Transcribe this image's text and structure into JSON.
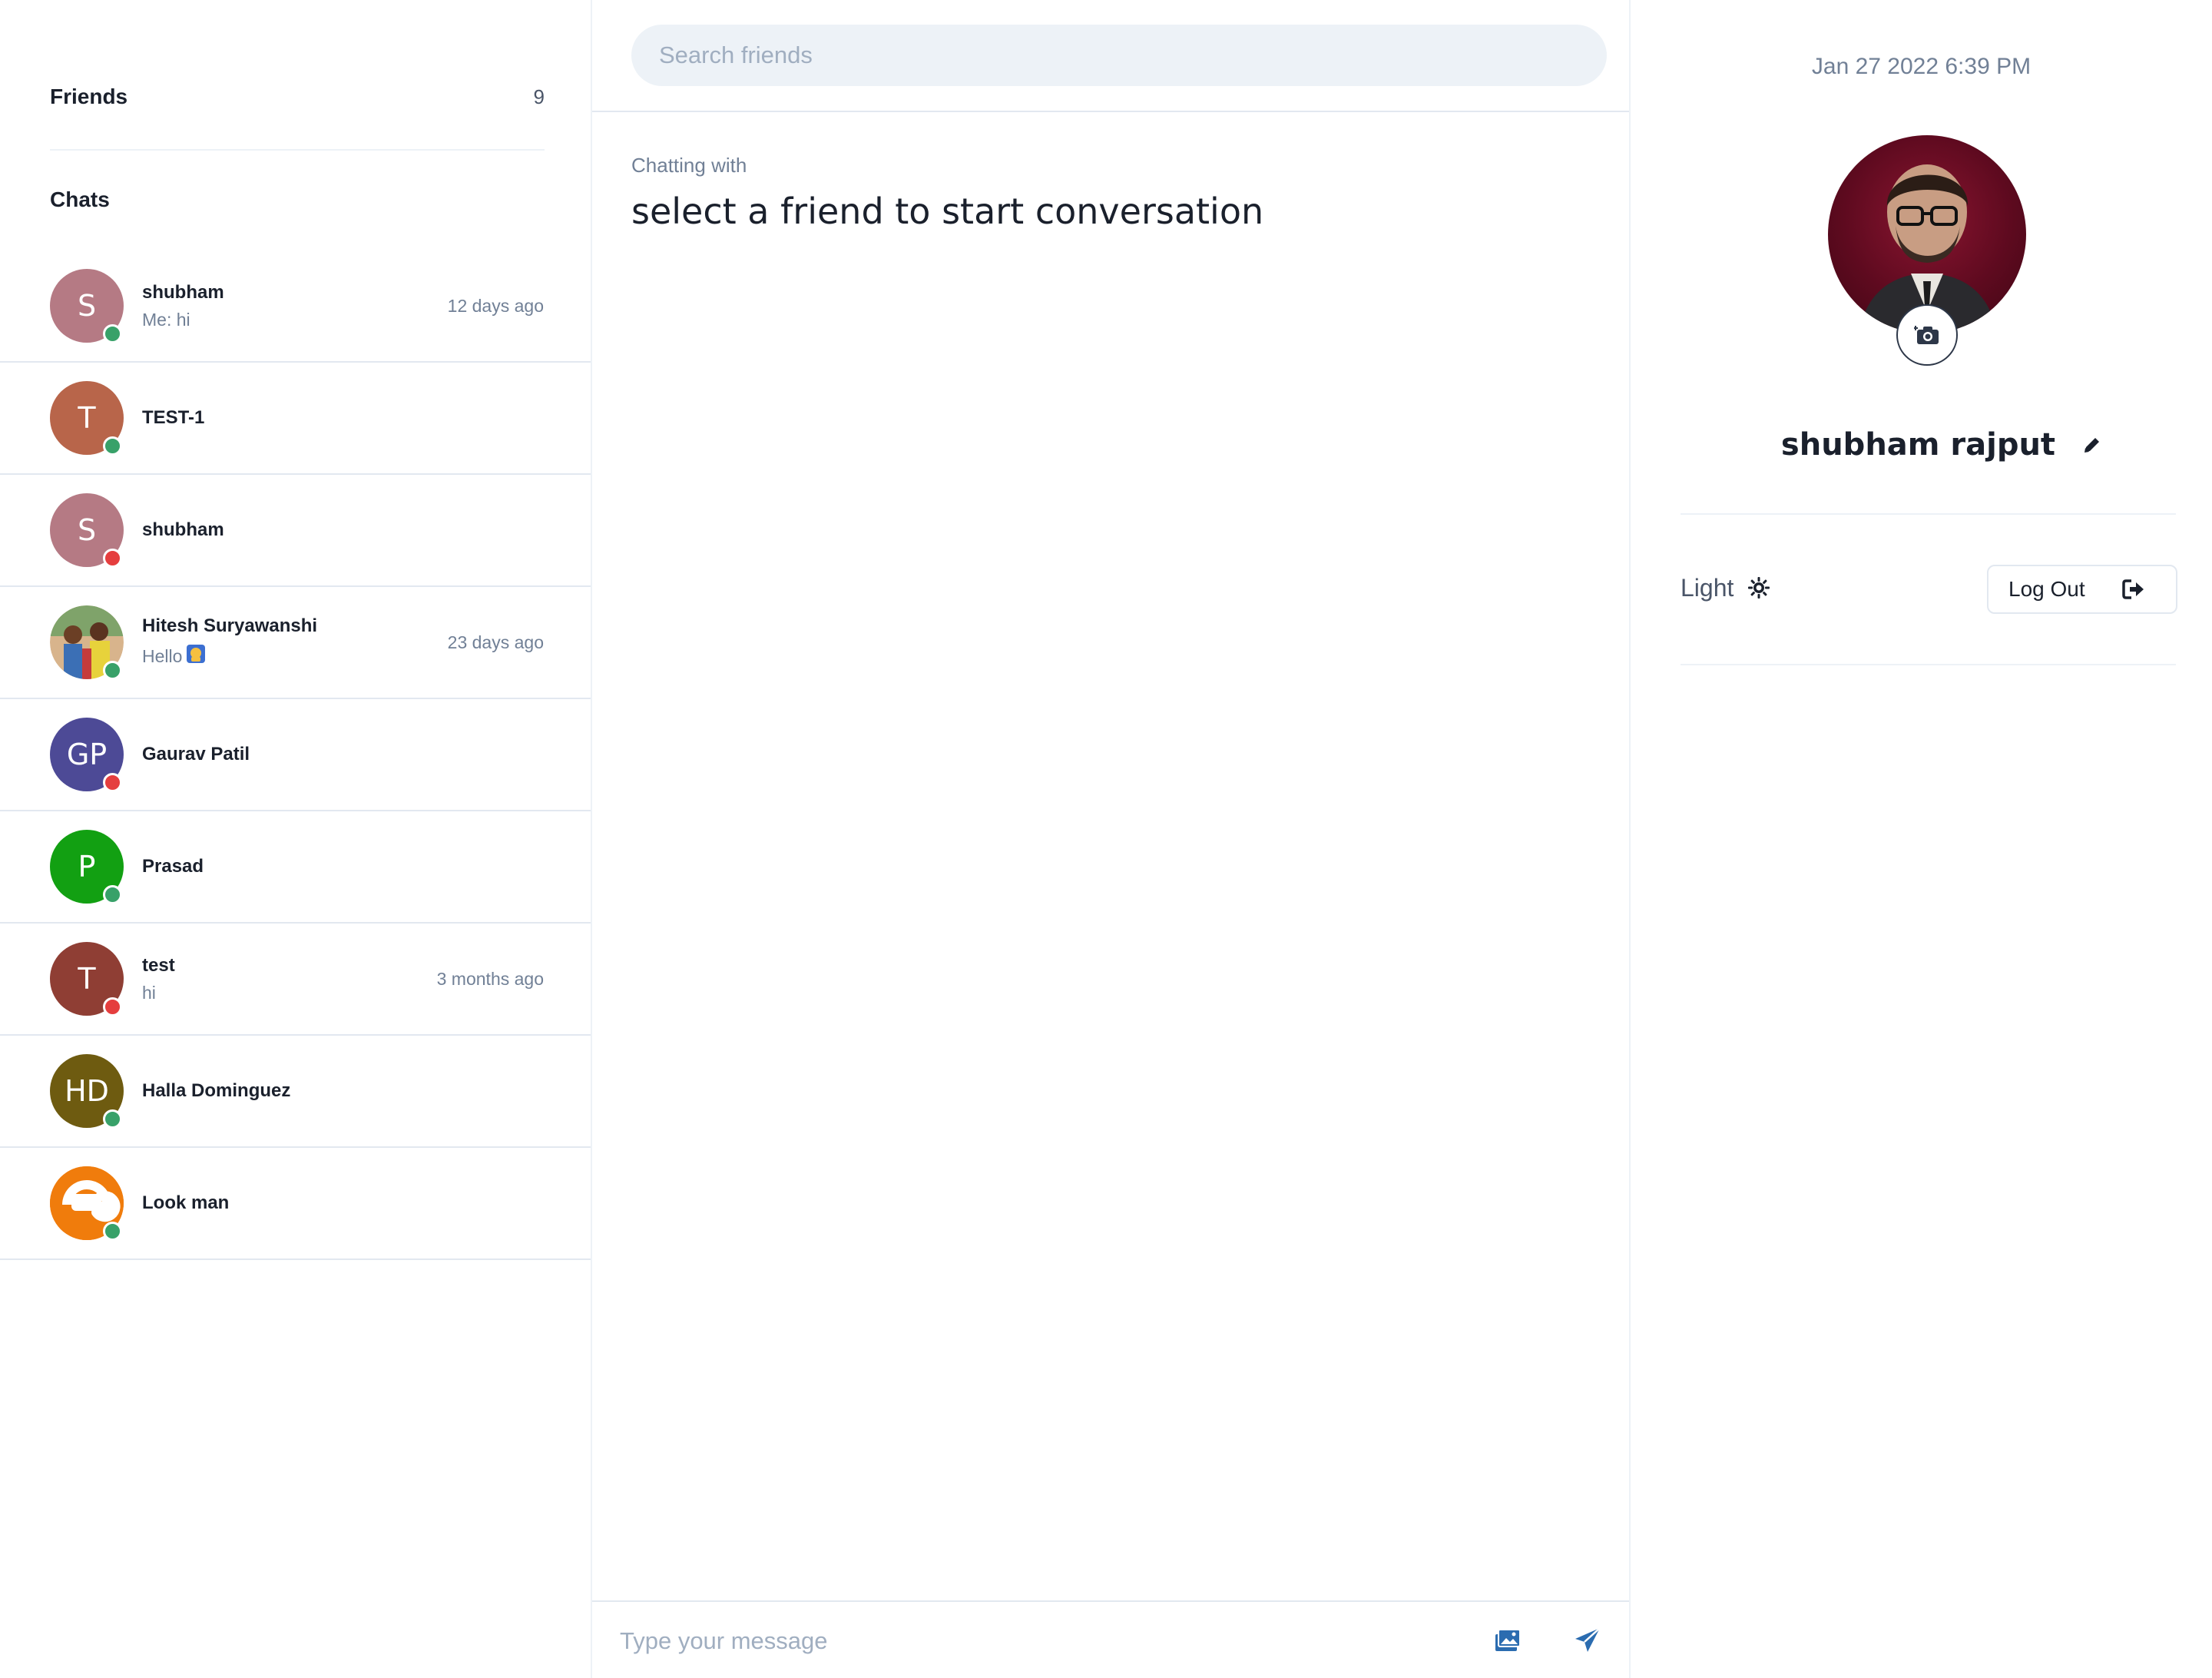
{
  "sidebar": {
    "friends_label": "Friends",
    "friends_count": "9",
    "chats_label": "Chats",
    "chats": [
      {
        "initial": "S",
        "name": "shubham",
        "preview": "Me: hi",
        "time": "12 days ago",
        "avatar_color": "#b57a84",
        "status_color": "#38a169"
      },
      {
        "initial": "T",
        "name": "TEST-1",
        "preview": "",
        "time": "",
        "avatar_color": "#b8654a",
        "status_color": "#38a169"
      },
      {
        "initial": "S",
        "name": "shubham",
        "preview": "",
        "time": "",
        "avatar_color": "#b57a84",
        "status_color": "#e53e3e"
      },
      {
        "initial": "",
        "name": "Hitesh Suryawanshi",
        "preview": "Hello",
        "time": "23 days ago",
        "avatar_color": "#c9a27a",
        "status_color": "#38a169"
      },
      {
        "initial": "GP",
        "name": "Gaurav Patil",
        "preview": "",
        "time": "",
        "avatar_color": "#4d4a96",
        "status_color": "#e53e3e"
      },
      {
        "initial": "P",
        "name": "Prasad",
        "preview": "",
        "time": "",
        "avatar_color": "#12a012",
        "status_color": "#38a169"
      },
      {
        "initial": "T",
        "name": "test",
        "preview": "hi",
        "time": "3 months ago",
        "avatar_color": "#8f3e34",
        "status_color": "#e53e3e"
      },
      {
        "initial": "HD",
        "name": "Halla Dominguez",
        "preview": "",
        "time": "",
        "avatar_color": "#6e5b10",
        "status_color": "#38a169"
      },
      {
        "initial": "",
        "name": "Look man",
        "preview": "",
        "time": "",
        "avatar_color": "#f07c0c",
        "status_color": "#38a169"
      }
    ]
  },
  "search": {
    "placeholder": "Search friends"
  },
  "conversation": {
    "chatting_label": "Chatting with",
    "title": "select a friend to start conversation"
  },
  "compose": {
    "placeholder": "Type your message"
  },
  "profile": {
    "datetime": "Jan 27 2022 6:39 PM",
    "name": "shubham rajput",
    "theme_label": "Light",
    "logout_label": "Log Out"
  },
  "colors": {
    "online": "#38a169",
    "offline": "#e53e3e",
    "accent": "#2b6cb0",
    "border": "#e2e8f0"
  },
  "icons": {
    "camera": "camera-icon",
    "edit": "pencil-icon",
    "theme": "sun-icon",
    "logout": "logout-icon",
    "image": "image-icon",
    "send": "send-icon"
  }
}
